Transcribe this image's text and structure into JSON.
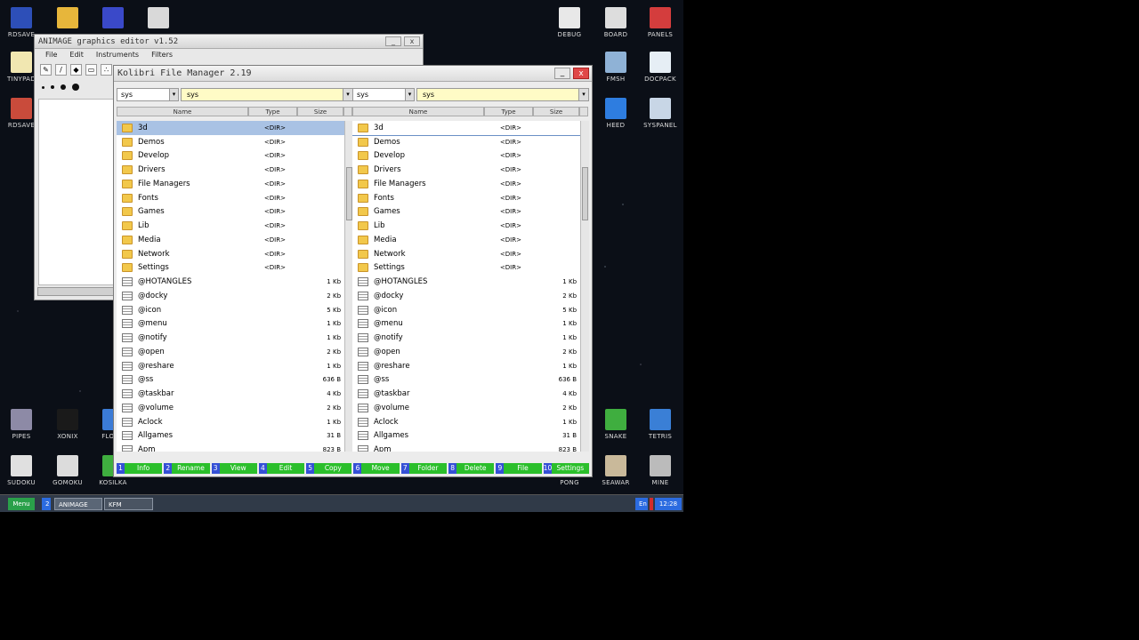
{
  "desktop_icons": [
    {
      "label": "RDSAVE",
      "icon": "floppy-icon",
      "color": "#2d4fb8"
    },
    {
      "label": "",
      "icon": "folder-icon",
      "color": "#e7b63b"
    },
    {
      "label": "",
      "icon": "image-icon",
      "color": "#3a49c9"
    },
    {
      "label": "",
      "icon": "calculator-icon",
      "color": "#d9d9d9"
    },
    {
      "label": "TINYPAD",
      "icon": "notepad-icon",
      "color": "#f1e7b1"
    },
    {
      "label": "RDSAVE",
      "icon": "rdsave-icon",
      "color": "#c94b3b"
    },
    {
      "label": "DEBUG",
      "icon": "debug-icon",
      "color": "#e8e8e8"
    },
    {
      "label": "BOARD",
      "icon": "board-icon",
      "color": "#dddddd"
    },
    {
      "label": "PANELS",
      "icon": "panels-icon",
      "color": "#d43d3d"
    },
    {
      "label": "FMSH",
      "icon": "fmsh-icon",
      "color": "#8fb2d6"
    },
    {
      "label": "DOCPACK",
      "icon": "docpack-icon",
      "color": "#e6eef5"
    },
    {
      "label": "HEED",
      "icon": "heed-icon",
      "color": "#2e7de0"
    },
    {
      "label": "SYSPANEL",
      "icon": "syspanel-icon",
      "color": "#c8d6e6"
    },
    {
      "label": "PIPES",
      "icon": "pipes-icon",
      "color": "#8d8aa6"
    },
    {
      "label": "XONIX",
      "icon": "xonix-icon",
      "color": "#1a1a1a"
    },
    {
      "label": "FLOOD",
      "icon": "flood-icon",
      "color": "#3b7bd6"
    },
    {
      "label": "SNAKE",
      "icon": "snake-icon",
      "color": "#3fae3f"
    },
    {
      "label": "TETRIS",
      "icon": "tetris-icon",
      "color": "#3a7fd6"
    },
    {
      "label": "SUDOKU",
      "icon": "sudoku-icon",
      "color": "#e0e0e0"
    },
    {
      "label": "GOMOKU",
      "icon": "gomoku-icon",
      "color": "#dcdcdc"
    },
    {
      "label": "KOSILKA",
      "icon": "kosilka-icon",
      "color": "#3fae3f"
    },
    {
      "label": "PONG",
      "icon": "pong-icon",
      "color": "#444444"
    },
    {
      "label": "SEAWAR",
      "icon": "seawar-icon",
      "color": "#c9b99a"
    },
    {
      "label": "MINE",
      "icon": "mine-icon",
      "color": "#bbbbbb"
    }
  ],
  "paint": {
    "title": "ANIMAGE graphics editor v1.52",
    "menu": [
      "File",
      "Edit",
      "Instruments",
      "Filters"
    ]
  },
  "fm": {
    "title": "Kolibri File Manager 2.19",
    "panels": [
      {
        "drive": "sys",
        "path": "sys"
      },
      {
        "drive": "sys",
        "path": "sys"
      }
    ],
    "columns": {
      "name": "Name",
      "type": "Type",
      "size": "Size"
    },
    "files": [
      {
        "name": "3d",
        "type": "<DIR>",
        "size": "",
        "dir": true
      },
      {
        "name": "Demos",
        "type": "<DIR>",
        "size": "",
        "dir": true
      },
      {
        "name": "Develop",
        "type": "<DIR>",
        "size": "",
        "dir": true
      },
      {
        "name": "Drivers",
        "type": "<DIR>",
        "size": "",
        "dir": true
      },
      {
        "name": "File Managers",
        "type": "<DIR>",
        "size": "",
        "dir": true
      },
      {
        "name": "Fonts",
        "type": "<DIR>",
        "size": "",
        "dir": true
      },
      {
        "name": "Games",
        "type": "<DIR>",
        "size": "",
        "dir": true
      },
      {
        "name": "Lib",
        "type": "<DIR>",
        "size": "",
        "dir": true
      },
      {
        "name": "Media",
        "type": "<DIR>",
        "size": "",
        "dir": true
      },
      {
        "name": "Network",
        "type": "<DIR>",
        "size": "",
        "dir": true
      },
      {
        "name": "Settings",
        "type": "<DIR>",
        "size": "",
        "dir": true
      },
      {
        "name": "@HOTANGLES",
        "type": "",
        "size": "1 Kb",
        "dir": false
      },
      {
        "name": "@docky",
        "type": "",
        "size": "2 Kb",
        "dir": false
      },
      {
        "name": "@icon",
        "type": "",
        "size": "5 Kb",
        "dir": false
      },
      {
        "name": "@menu",
        "type": "",
        "size": "1 Kb",
        "dir": false
      },
      {
        "name": "@notify",
        "type": "",
        "size": "1 Kb",
        "dir": false
      },
      {
        "name": "@open",
        "type": "",
        "size": "2 Kb",
        "dir": false
      },
      {
        "name": "@reshare",
        "type": "",
        "size": "1 Kb",
        "dir": false
      },
      {
        "name": "@ss",
        "type": "",
        "size": "636 B",
        "dir": false
      },
      {
        "name": "@taskbar",
        "type": "",
        "size": "4 Kb",
        "dir": false
      },
      {
        "name": "@volume",
        "type": "",
        "size": "2 Kb",
        "dir": false
      },
      {
        "name": "Aclock",
        "type": "",
        "size": "1 Kb",
        "dir": false
      },
      {
        "name": "Allgames",
        "type": "",
        "size": "31 B",
        "dir": false
      },
      {
        "name": "Apm",
        "type": "",
        "size": "823 B",
        "dir": false
      }
    ],
    "fkeys": [
      {
        "key": "1",
        "label": "Info"
      },
      {
        "key": "2",
        "label": "Rename"
      },
      {
        "key": "3",
        "label": "View"
      },
      {
        "key": "4",
        "label": "Edit"
      },
      {
        "key": "5",
        "label": "Copy"
      },
      {
        "key": "6",
        "label": "Move"
      },
      {
        "key": "7",
        "label": "Folder"
      },
      {
        "key": "8",
        "label": "Delete"
      },
      {
        "key": "9",
        "label": "File"
      },
      {
        "key": "10",
        "label": "Settings"
      }
    ]
  },
  "taskbar": {
    "menu": "Menu",
    "num": "2",
    "task1": "ANIMAGE",
    "task2": "KFM",
    "lang": "En",
    "time": "12:28"
  }
}
